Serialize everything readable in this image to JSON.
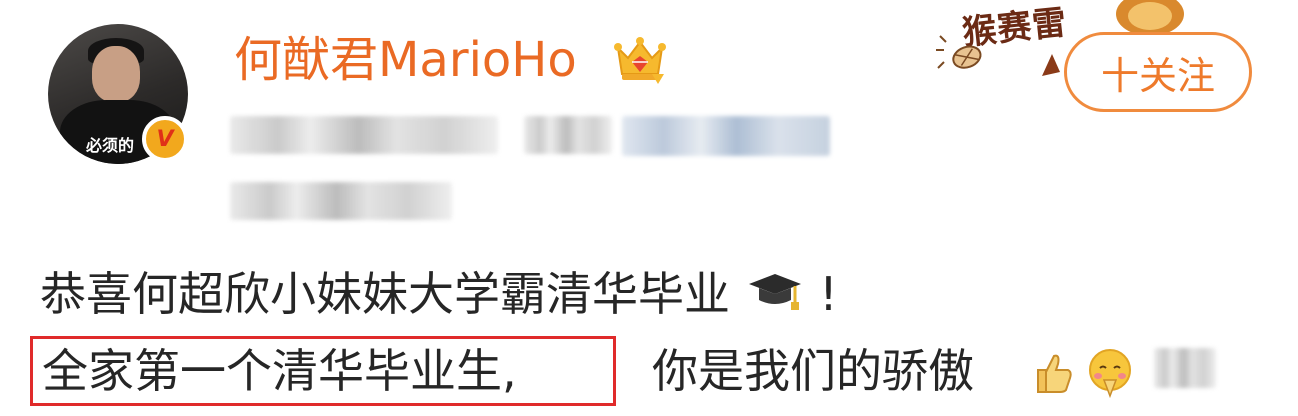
{
  "user": {
    "name": "何猷君MarioHo",
    "avatar_caption": "必须的",
    "verified_mark": "V"
  },
  "decoration": {
    "text": "猴赛雷"
  },
  "follow_button": {
    "label": "十关注"
  },
  "post": {
    "line_1": "恭喜何超欣小妹妹大学霸清华毕业",
    "line_1_end": "!",
    "highlighted_text": "全家第一个清华毕业生,",
    "line_2": "你是我们的骄傲"
  },
  "colors": {
    "username": "#ea6a24",
    "follow_accent": "#f08b3e",
    "highlight_border": "#e02a2a"
  }
}
